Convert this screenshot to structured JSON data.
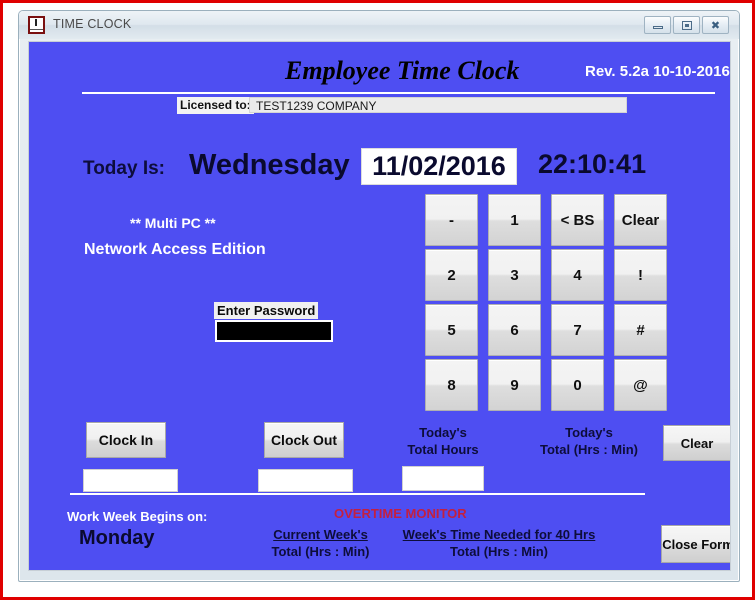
{
  "window": {
    "title": "TIME CLOCK",
    "icon": "clock-icon",
    "controls": {
      "minimize": "minimize-icon",
      "maximize": "maximize-icon",
      "close": "close-icon"
    }
  },
  "header": {
    "form_title": "Employee Time Clock",
    "revision": "Rev. 5.2a  10-10-2016",
    "licensed_label": "Licensed to:",
    "licensed_value": "TEST1239 COMPANY"
  },
  "today": {
    "label": "Today Is:",
    "weekday": "Wednesday",
    "date": "11/02/2016",
    "time": "22:10:41"
  },
  "edition": {
    "line1": "** Multi PC **",
    "line2": "Network Access Edition"
  },
  "password": {
    "label": "Enter Password",
    "value": "",
    "placeholder": ""
  },
  "keypad": {
    "keys": [
      "-",
      "1",
      "< BS",
      "Clear",
      "2",
      "3",
      "4",
      "!",
      "5",
      "6",
      "7",
      "#",
      "8",
      "9",
      "0",
      "@"
    ]
  },
  "actions": {
    "clock_in": "Clock In",
    "clock_out": "Clock Out",
    "clear_totals": "Clear",
    "close_form": "Close Form"
  },
  "fields": {
    "clock_in_value": "",
    "clock_out_value": "",
    "total_hours_value": ""
  },
  "totals": {
    "todays_total_hours_line1": "Today's",
    "todays_total_hours_line2": "Total Hours",
    "todays_total_hm_line1": "Today's",
    "todays_total_hm_line2": "Total (Hrs : Min)"
  },
  "footer": {
    "work_week_label": "Work Week Begins on:",
    "work_week_day": "Monday",
    "overtime_monitor": "OVERTIME MONITOR",
    "current_week_head": "Current Week's",
    "current_week_sub": "Total (Hrs : Min)",
    "needed_40_head": "Week's Time Needed for 40 Hrs",
    "needed_40_sub": "Total (Hrs : Min)"
  },
  "colors": {
    "form_background": "#4e4ef2",
    "accent_red": "#c32040",
    "title_text": "#000000",
    "white_text": "#ffffff",
    "dark_navy": "#0a0a2e",
    "annotation_border": "#e00000"
  }
}
